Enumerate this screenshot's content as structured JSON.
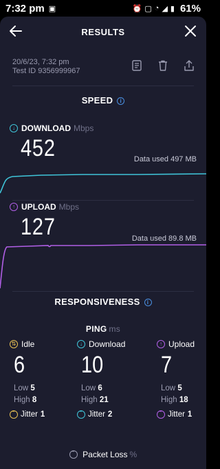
{
  "status": {
    "time": "7:32 pm",
    "battery": "61%"
  },
  "header": {
    "title": "RESULTS"
  },
  "meta": {
    "datetime": "20/6/23, 7:32 pm",
    "test_id": "Test ID 9356999967"
  },
  "speed": {
    "title": "SPEED",
    "download": {
      "label": "DOWNLOAD",
      "unit": "Mbps",
      "value": "452",
      "data_used": "Data used 497 MB",
      "color": "#3fc4d8"
    },
    "upload": {
      "label": "UPLOAD",
      "unit": "Mbps",
      "value": "127",
      "data_used": "Data used 89.8 MB",
      "color": "#b15fe6"
    }
  },
  "responsiveness": {
    "title": "RESPONSIVENESS",
    "ping": {
      "label": "PING",
      "unit": "ms"
    },
    "idle": {
      "label": "Idle",
      "value": "6",
      "low_label": "Low",
      "low": "5",
      "high_label": "High",
      "high": "8",
      "jitter_label": "Jitter",
      "jitter": "1",
      "color": "#e8c154"
    },
    "download": {
      "label": "Download",
      "value": "10",
      "low_label": "Low",
      "low": "6",
      "high_label": "High",
      "high": "21",
      "jitter_label": "Jitter",
      "jitter": "2",
      "color": "#3fc4d8"
    },
    "upload": {
      "label": "Upload",
      "value": "7",
      "low_label": "Low",
      "low": "5",
      "high_label": "High",
      "high": "18",
      "jitter_label": "Jitter",
      "jitter": "1",
      "color": "#b15fe6"
    }
  },
  "packet_loss": {
    "label": "Packet Loss",
    "unit": "%"
  }
}
